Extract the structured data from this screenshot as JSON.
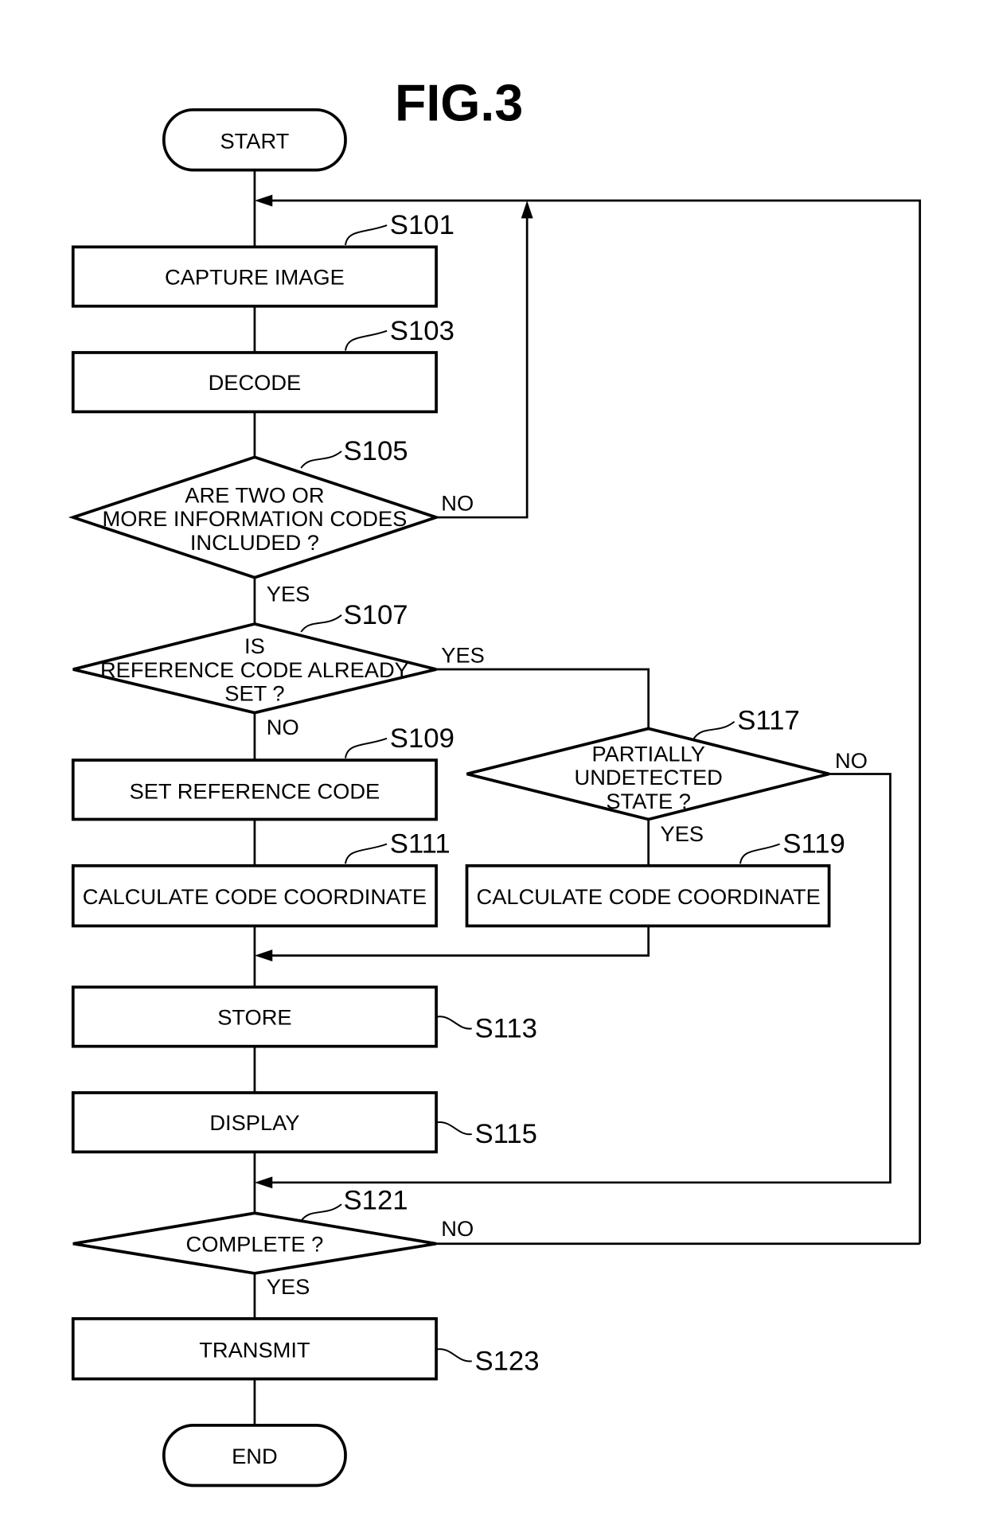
{
  "figure": {
    "title": "FIG.3"
  },
  "nodes": {
    "start": {
      "type": "terminal",
      "text": [
        "START"
      ]
    },
    "s101": {
      "type": "process",
      "step": "S101",
      "text": [
        "CAPTURE IMAGE"
      ]
    },
    "s103": {
      "type": "process",
      "step": "S103",
      "text": [
        "DECODE"
      ]
    },
    "s105": {
      "type": "decision",
      "step": "S105",
      "text": [
        "ARE TWO OR",
        "MORE INFORMATION CODES",
        "INCLUDED ?"
      ]
    },
    "s107": {
      "type": "decision",
      "step": "S107",
      "text": [
        "IS",
        "REFERENCE CODE ALREADY",
        "SET ?"
      ]
    },
    "s109": {
      "type": "process",
      "step": "S109",
      "text": [
        "SET REFERENCE CODE"
      ]
    },
    "s111": {
      "type": "process",
      "step": "S111",
      "text": [
        "CALCULATE CODE COORDINATE"
      ]
    },
    "s117": {
      "type": "decision",
      "step": "S117",
      "text": [
        "PARTIALLY",
        "UNDETECTED",
        "STATE ?"
      ]
    },
    "s119": {
      "type": "process",
      "step": "S119",
      "text": [
        "CALCULATE CODE COORDINATE"
      ]
    },
    "s113": {
      "type": "process",
      "step": "S113",
      "text": [
        "STORE"
      ]
    },
    "s115": {
      "type": "process",
      "step": "S115",
      "text": [
        "DISPLAY"
      ]
    },
    "s121": {
      "type": "decision",
      "step": "S121",
      "text": [
        "COMPLETE ?"
      ]
    },
    "s123": {
      "type": "process",
      "step": "S123",
      "text": [
        "TRANSMIT"
      ]
    },
    "end": {
      "type": "terminal",
      "text": [
        "END"
      ]
    }
  },
  "edges": [
    {
      "from": "start",
      "to": "s101",
      "label": ""
    },
    {
      "from": "s101",
      "to": "s103",
      "label": ""
    },
    {
      "from": "s103",
      "to": "s105",
      "label": ""
    },
    {
      "from": "s105",
      "to": "s101",
      "label": "NO"
    },
    {
      "from": "s105",
      "to": "s107",
      "label": "YES"
    },
    {
      "from": "s107",
      "to": "s117",
      "label": "YES"
    },
    {
      "from": "s107",
      "to": "s109",
      "label": "NO"
    },
    {
      "from": "s109",
      "to": "s111",
      "label": ""
    },
    {
      "from": "s117",
      "to": "s119",
      "label": "YES"
    },
    {
      "from": "s117",
      "to": "s121",
      "label": "NO"
    },
    {
      "from": "s111",
      "to": "s113",
      "label": ""
    },
    {
      "from": "s119",
      "to": "s113",
      "label": ""
    },
    {
      "from": "s113",
      "to": "s115",
      "label": ""
    },
    {
      "from": "s115",
      "to": "s121",
      "label": ""
    },
    {
      "from": "s121",
      "to": "s101",
      "label": "NO"
    },
    {
      "from": "s121",
      "to": "s123",
      "label": "YES"
    },
    {
      "from": "s123",
      "to": "end",
      "label": ""
    }
  ],
  "branch_labels": {
    "s105_no": "NO",
    "s105_yes": "YES",
    "s107_yes": "YES",
    "s107_no": "NO",
    "s117_no": "NO",
    "s117_yes": "YES",
    "s121_no": "NO",
    "s121_yes": "YES"
  }
}
